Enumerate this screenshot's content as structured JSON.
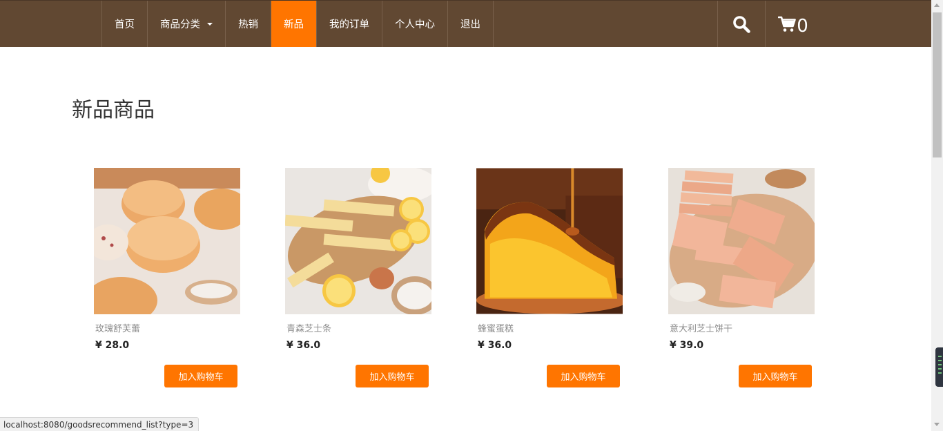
{
  "nav": {
    "items": [
      {
        "label": "首页"
      },
      {
        "label": "商品分类"
      },
      {
        "label": "热销"
      },
      {
        "label": "新品"
      },
      {
        "label": "我的订单"
      },
      {
        "label": "个人中心"
      },
      {
        "label": "退出"
      }
    ],
    "active_item": "新品",
    "search_icon": "search-icon",
    "cart_icon": "shopping-cart-icon",
    "cart_count": "0"
  },
  "colors": {
    "navbar_bg": "#614832",
    "accent": "#ff7500"
  },
  "page": {
    "title": "新品商品"
  },
  "products": [
    {
      "name": "玫瑰舒芙蕾",
      "price": "¥ 28.0",
      "button": "加入购物车"
    },
    {
      "name": "青森芝士条",
      "price": "¥ 36.0",
      "button": "加入购物车"
    },
    {
      "name": "蜂蜜蛋糕",
      "price": "¥ 36.0",
      "button": "加入购物车"
    },
    {
      "name": "意大利芝士饼干",
      "price": "¥ 39.0",
      "button": "加入购物车"
    }
  ],
  "status_bar": {
    "url": "localhost:8080/goodsrecommend_list?type=3"
  }
}
